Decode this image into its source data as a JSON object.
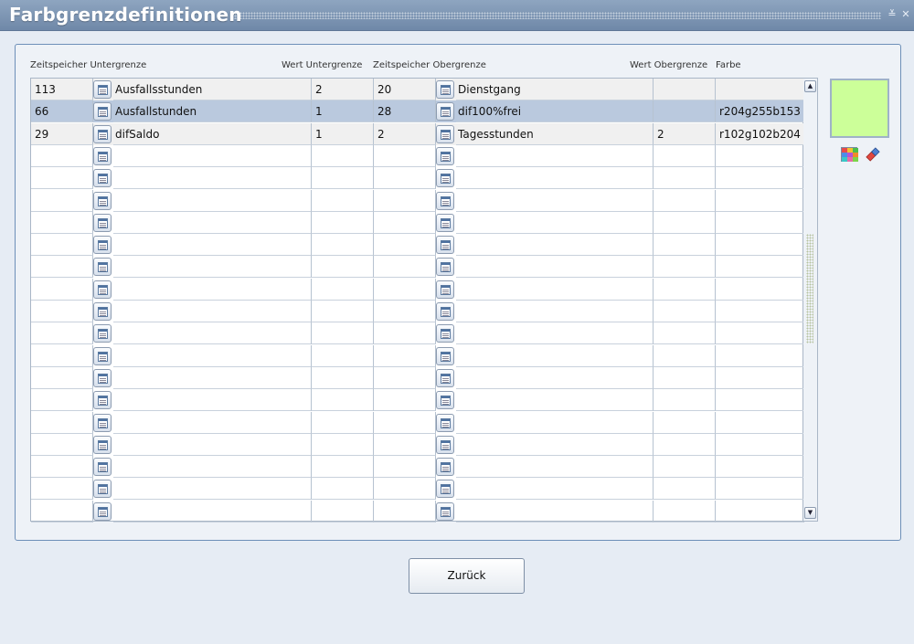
{
  "window": {
    "title": "Farbgrenzdefinitionen",
    "minimize_glyph": "≚",
    "close_glyph": "✕"
  },
  "columns": [
    "Zeitspeicher Untergrenze",
    "Wert Untergrenze",
    "Zeitspeicher Obergrenze",
    "Wert Obergrenze",
    "Farbe"
  ],
  "rows": [
    {
      "zs_unter_id": "113",
      "zs_unter_name": "Ausfallsstunden",
      "wert_unter": "2",
      "zs_ober_id": "20",
      "zs_ober_name": "Dienstgang",
      "wert_ober": "",
      "farbe": ""
    },
    {
      "zs_unter_id": "66",
      "zs_unter_name": "Ausfallstunden",
      "wert_unter": "1",
      "zs_ober_id": "28",
      "zs_ober_name": "dif100%frei",
      "wert_ober": "",
      "farbe": "r204g255b153"
    },
    {
      "zs_unter_id": "29",
      "zs_unter_name": "difSaldo",
      "wert_unter": "1",
      "zs_ober_id": "2",
      "zs_ober_name": "Tagesstunden",
      "wert_ober": "2",
      "farbe": "r102g102b204"
    }
  ],
  "empty_row_count": 17,
  "selected_row_index": 1,
  "color_preview": {
    "color": "#ccff99"
  },
  "icons": {
    "cell_picker": "list-picker-icon",
    "palette": "color-palette-icon",
    "eraser": "eraser-icon",
    "scroll_up": "▲",
    "scroll_down": "▼"
  },
  "colors": {
    "title_bar": "#7e96b5",
    "selected_row": "#bac9de",
    "panel_border": "#6d8fb8"
  },
  "buttons": {
    "back_label": "Zurück"
  }
}
